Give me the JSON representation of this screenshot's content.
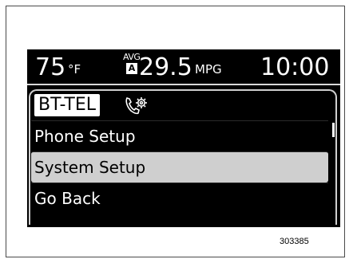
{
  "status": {
    "temperature": "75",
    "temperature_unit": "°F",
    "avg_label": "AVG",
    "avg_badge": "A",
    "mpg_value": "29.5",
    "mpg_unit": "MPG",
    "clock": "10:00"
  },
  "header": {
    "mode_label": "BT-TEL",
    "icon": "phone-gear-icon"
  },
  "menu": {
    "items": [
      {
        "label": "Phone Setup",
        "selected": false
      },
      {
        "label": "System Setup",
        "selected": true
      },
      {
        "label": "Go Back",
        "selected": false
      }
    ]
  },
  "scroll": {
    "position": 0.0
  },
  "figure_code": "303385",
  "colors": {
    "screen_background": "#000000",
    "selected_row": "#cfcfcf",
    "text": "#ffffff"
  }
}
